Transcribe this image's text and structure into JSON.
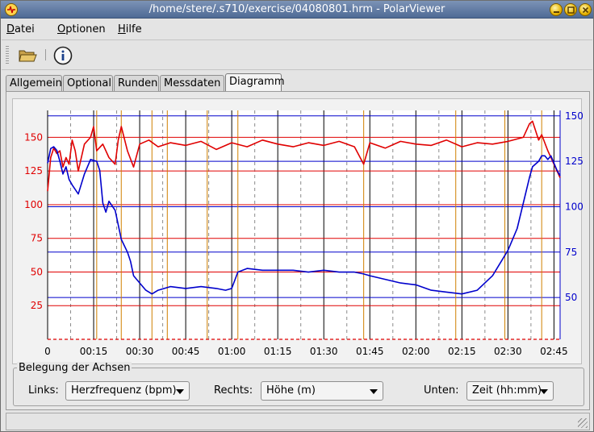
{
  "window": {
    "title": "/home/stere/.s710/exercise/04080801.hrm - PolarViewer"
  },
  "menu": {
    "items": [
      {
        "label": "Datei",
        "accel": "D",
        "rest": "atei"
      },
      {
        "label": "Optionen",
        "accel": "O",
        "rest": "ptionen"
      },
      {
        "label": "Hilfe",
        "accel": "H",
        "rest": "ilfe"
      }
    ]
  },
  "toolbar": {
    "open_icon": "folder-open-icon",
    "info_icon": "info-icon"
  },
  "tabs": [
    {
      "label": "Allgemein",
      "active": false
    },
    {
      "label": "Optional",
      "active": false
    },
    {
      "label": "Runden",
      "active": false
    },
    {
      "label": "Messdaten",
      "active": false
    },
    {
      "label": "Diagramm",
      "active": true
    }
  ],
  "axes_settings": {
    "group_title": "Belegung der Achsen",
    "left_label": "Links:",
    "left_value": "Herzfrequenz (bpm)",
    "right_label": "Rechts:",
    "right_value": "Höhe (m)",
    "bottom_label": "Unten:",
    "bottom_value": "Zeit (hh:mm)"
  },
  "colors": {
    "heart_rate": "#e00000",
    "altitude": "#0000cc",
    "lap_marker": "#d08000",
    "grid": "#000000"
  },
  "chart_data": {
    "type": "line",
    "x_ticks": [
      "0",
      "00:15",
      "00:30",
      "00:45",
      "01:00",
      "01:15",
      "01:30",
      "01:45",
      "02:00",
      "02:15",
      "02:30",
      "02:45"
    ],
    "x_tick_minutes": [
      0,
      15,
      30,
      45,
      60,
      75,
      90,
      105,
      120,
      135,
      150,
      165
    ],
    "xlim": [
      0,
      167
    ],
    "left_ticks": [
      25,
      50,
      75,
      100,
      125,
      150
    ],
    "left_ylim": [
      0,
      170
    ],
    "right_ticks": [
      50,
      75,
      100,
      125,
      150
    ],
    "right_ylim": [
      27,
      153
    ],
    "lap_markers_minutes": [
      16,
      24,
      34,
      39,
      52,
      62,
      103,
      133,
      149,
      161
    ],
    "series": [
      {
        "axis": "left",
        "color": "#e00000",
        "x": [
          0,
          1,
          2,
          3,
          4,
          5,
          6,
          7,
          8,
          9,
          10,
          12,
          14,
          15,
          16,
          18,
          20,
          22,
          23,
          24,
          26,
          28,
          30,
          33,
          36,
          40,
          45,
          50,
          55,
          60,
          65,
          70,
          75,
          80,
          85,
          90,
          95,
          100,
          103,
          105,
          110,
          115,
          120,
          125,
          130,
          135,
          140,
          145,
          150,
          155,
          157,
          158,
          160,
          161,
          163,
          165,
          167
        ],
        "y": [
          110,
          135,
          142,
          138,
          140,
          128,
          135,
          130,
          148,
          140,
          125,
          145,
          150,
          158,
          140,
          145,
          135,
          130,
          148,
          158,
          140,
          128,
          145,
          148,
          143,
          146,
          144,
          147,
          141,
          146,
          143,
          148,
          145,
          143,
          146,
          144,
          147,
          143,
          130,
          146,
          142,
          147,
          145,
          144,
          148,
          143,
          146,
          145,
          147,
          150,
          160,
          162,
          148,
          152,
          140,
          130,
          120
        ]
      },
      {
        "axis": "right",
        "color": "#0000cc",
        "x": [
          0,
          1,
          2,
          3,
          4,
          5,
          6,
          7,
          8,
          10,
          12,
          13,
          14,
          16,
          17,
          18,
          19,
          20,
          22,
          24,
          26,
          27,
          28,
          30,
          32,
          34,
          36,
          38,
          40,
          45,
          50,
          55,
          58,
          60,
          62,
          65,
          70,
          75,
          80,
          85,
          90,
          95,
          100,
          103,
          105,
          110,
          115,
          120,
          125,
          130,
          135,
          140,
          145,
          150,
          153,
          155,
          157,
          158,
          160,
          161,
          162,
          163,
          164,
          165,
          166,
          167
        ],
        "y": [
          124,
          132,
          133,
          131,
          125,
          118,
          122,
          115,
          112,
          107,
          118,
          122,
          126,
          125,
          120,
          102,
          97,
          103,
          98,
          82,
          75,
          70,
          62,
          58,
          54,
          52,
          54,
          55,
          56,
          55,
          56,
          55,
          54,
          55,
          64,
          66,
          65,
          65,
          65,
          64,
          65,
          64,
          64,
          63,
          62,
          60,
          58,
          57,
          54,
          53,
          52,
          54,
          62,
          76,
          88,
          102,
          116,
          122,
          125,
          128,
          128,
          126,
          128,
          124,
          120,
          117
        ]
      }
    ]
  }
}
